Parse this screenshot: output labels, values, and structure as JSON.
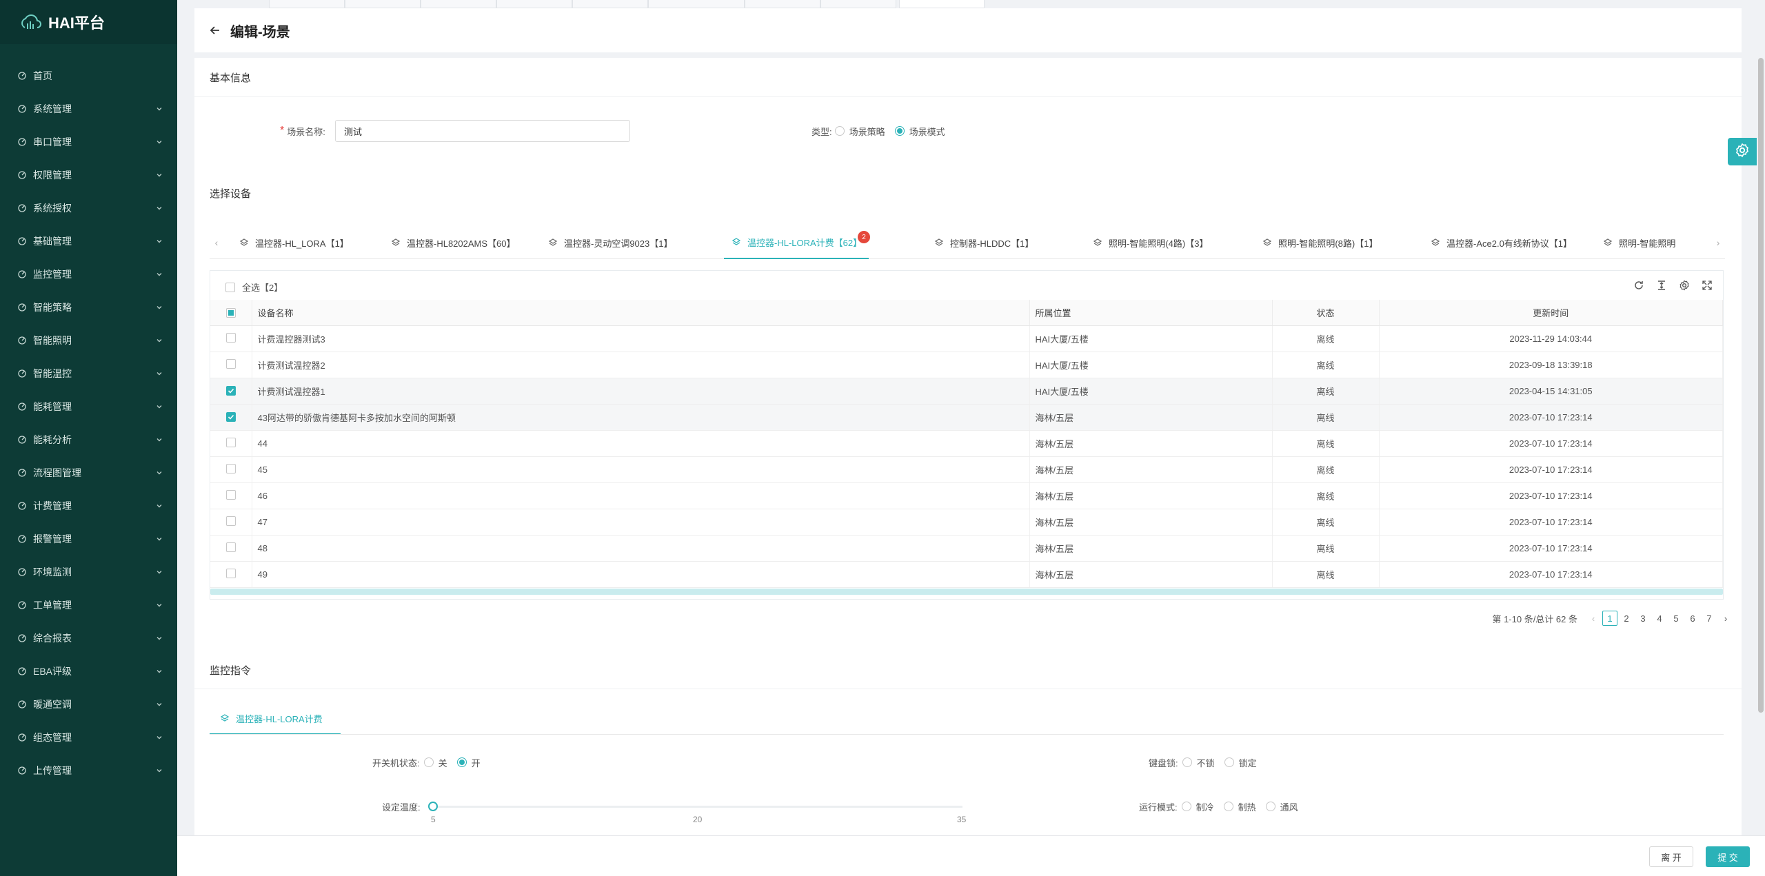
{
  "app": {
    "title": "HAI平台"
  },
  "sidebar": {
    "items": [
      {
        "label": "首页",
        "icon": "dashboard-icon",
        "expandable": false
      },
      {
        "label": "系统管理",
        "icon": "monitor-icon",
        "expandable": true
      },
      {
        "label": "串口管理",
        "icon": "port-icon",
        "expandable": true
      },
      {
        "label": "权限管理",
        "icon": "shield-icon",
        "expandable": true
      },
      {
        "label": "系统授权",
        "icon": "auth-icon",
        "expandable": true
      },
      {
        "label": "基础管理",
        "icon": "base-icon",
        "expandable": true
      },
      {
        "label": "监控管理",
        "icon": "monitor-icon",
        "expandable": true
      },
      {
        "label": "智能策略",
        "icon": "location-icon",
        "expandable": true
      },
      {
        "label": "智能照明",
        "icon": "bulb-icon",
        "expandable": true
      },
      {
        "label": "智能温控",
        "icon": "thermo-icon",
        "expandable": true
      },
      {
        "label": "能耗管理",
        "icon": "energy-icon",
        "expandable": true
      },
      {
        "label": "能耗分析",
        "icon": "chart-icon",
        "expandable": true
      },
      {
        "label": "流程图管理",
        "icon": "flow-icon",
        "expandable": true
      },
      {
        "label": "计费管理",
        "icon": "billing-icon",
        "expandable": true
      },
      {
        "label": "报警管理",
        "icon": "alarm-icon",
        "expandable": true
      },
      {
        "label": "环境监测",
        "icon": "leaf-icon",
        "expandable": true
      },
      {
        "label": "工单管理",
        "icon": "layers-icon",
        "expandable": true
      },
      {
        "label": "综合报表",
        "icon": "report-icon",
        "expandable": true
      },
      {
        "label": "EBA评级",
        "icon": "rating-icon",
        "expandable": true
      },
      {
        "label": "暖通空调",
        "icon": "hvac-icon",
        "expandable": true
      },
      {
        "label": "组态管理",
        "icon": "config-icon",
        "expandable": true
      },
      {
        "label": "上传管理",
        "icon": "upload-icon",
        "expandable": true
      }
    ]
  },
  "header": {
    "title": "编辑-场景"
  },
  "basic": {
    "section_title": "基本信息",
    "name_label": "场景名称:",
    "name_value": "测试",
    "type_label": "类型:",
    "type_options": [
      "场景策略",
      "场景模式"
    ],
    "type_selected": "场景模式"
  },
  "devices": {
    "section_title": "选择设备",
    "tabs": [
      {
        "label": "温控器-HL_LORA【1】",
        "active": false
      },
      {
        "label": "温控器-HL8202AMS【60】",
        "active": false
      },
      {
        "label": "温控器-灵动空调9023【1】",
        "active": false
      },
      {
        "label": "温控器-HL-LORA计费【62】",
        "active": true,
        "badge": "2"
      },
      {
        "label": "控制器-HLDDC【1】",
        "active": false
      },
      {
        "label": "照明-智能照明(4路)【3】",
        "active": false
      },
      {
        "label": "照明-智能照明(8路)【1】",
        "active": false
      },
      {
        "label": "温控器-Ace2.0有线新协议【1】",
        "active": false
      },
      {
        "label": "照明-智能照明",
        "active": false
      }
    ],
    "select_all_label": "全选【2】",
    "columns": [
      "设备名称",
      "所属位置",
      "状态",
      "更新时间"
    ],
    "rows": [
      {
        "name": "计费温控器测试3",
        "location": "HAI大厦/五楼",
        "status": "离线",
        "updated": "2023-11-29 14:03:44",
        "checked": false
      },
      {
        "name": "计费测试温控器2",
        "location": "HAI大厦/五楼",
        "status": "离线",
        "updated": "2023-09-18 13:39:18",
        "checked": false
      },
      {
        "name": "计费测试温控器1",
        "location": "HAI大厦/五楼",
        "status": "离线",
        "updated": "2023-04-15 14:31:05",
        "checked": true
      },
      {
        "name": "43阿达带的骄傲肯德基阿卡多按加水空间的阿斯顿",
        "location": "海林/五层",
        "status": "离线",
        "updated": "2023-07-10 17:23:14",
        "checked": true
      },
      {
        "name": "44",
        "location": "海林/五层",
        "status": "离线",
        "updated": "2023-07-10 17:23:14",
        "checked": false
      },
      {
        "name": "45",
        "location": "海林/五层",
        "status": "离线",
        "updated": "2023-07-10 17:23:14",
        "checked": false
      },
      {
        "name": "46",
        "location": "海林/五层",
        "status": "离线",
        "updated": "2023-07-10 17:23:14",
        "checked": false
      },
      {
        "name": "47",
        "location": "海林/五层",
        "status": "离线",
        "updated": "2023-07-10 17:23:14",
        "checked": false
      },
      {
        "name": "48",
        "location": "海林/五层",
        "status": "离线",
        "updated": "2023-07-10 17:23:14",
        "checked": false
      },
      {
        "name": "49",
        "location": "海林/五层",
        "status": "离线",
        "updated": "2023-07-10 17:23:14",
        "checked": false
      }
    ],
    "pagination": {
      "summary": "第 1-10 条/总计 62 条",
      "pages": [
        "1",
        "2",
        "3",
        "4",
        "5",
        "6",
        "7"
      ],
      "current": "1"
    }
  },
  "monitor": {
    "section_title": "监控指令",
    "tab_label": "温控器-HL-LORA计费",
    "power_label": "开关机状态:",
    "power_options": [
      "关",
      "开"
    ],
    "power_selected": "开",
    "lock_label": "键盘锁:",
    "lock_options": [
      "不锁",
      "锁定"
    ],
    "temp_label": "设定温度:",
    "temp_min": "5",
    "temp_mid": "20",
    "temp_max": "35",
    "temp_value": 5,
    "mode_label": "运行模式:",
    "mode_options": [
      "制冷",
      "制热",
      "通风"
    ]
  },
  "footer": {
    "leave_label": "离 开",
    "submit_label": "提 交"
  },
  "colors": {
    "accent": "#2bb2b8",
    "sidebar": "#0d3b36",
    "badge": "#e5483b"
  }
}
